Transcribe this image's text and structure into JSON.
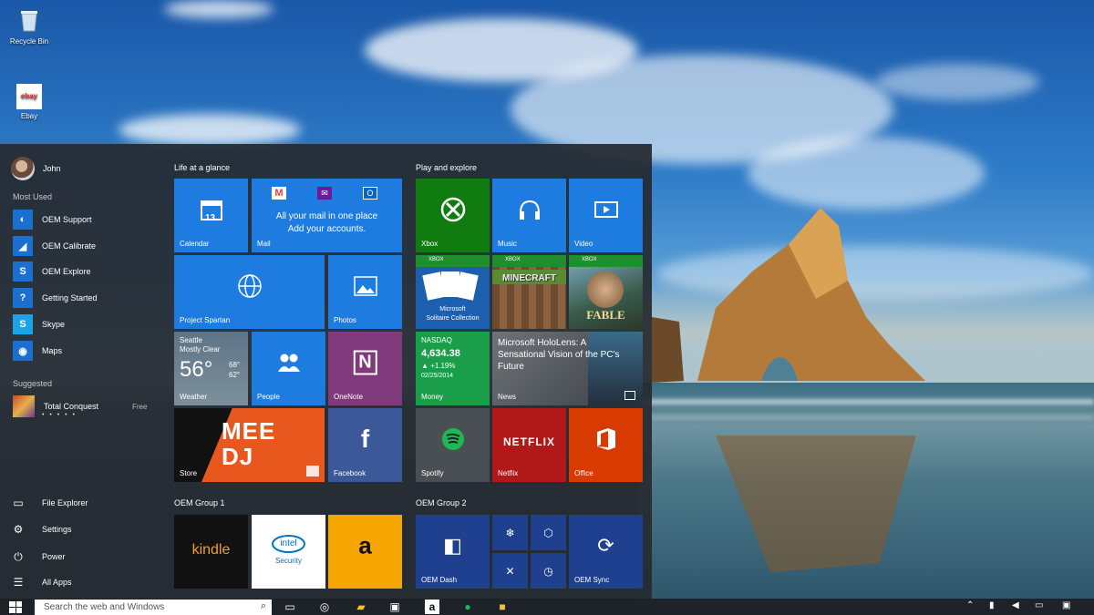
{
  "desktop": {
    "icons": [
      {
        "label": "Recycle Bin",
        "icon": "recycle-bin-icon"
      },
      {
        "label": "Ebay",
        "icon": "ebay-icon",
        "badge": "ebay"
      }
    ]
  },
  "start_menu": {
    "user": {
      "name": "John"
    },
    "most_used_label": "Most Used",
    "most_used": [
      {
        "label": "OEM Support",
        "icon": "oem-support-icon"
      },
      {
        "label": "OEM Calibrate",
        "icon": "oem-calibrate-icon"
      },
      {
        "label": "OEM Explore",
        "icon": "oem-explore-icon"
      },
      {
        "label": "Getting Started",
        "icon": "help-icon"
      },
      {
        "label": "Skype",
        "icon": "skype-icon"
      },
      {
        "label": "Maps",
        "icon": "maps-icon"
      }
    ],
    "suggested_label": "Suggested",
    "suggested": {
      "label": "Total Conquest",
      "note": "Free",
      "rating": "• • • • •"
    },
    "bottom": [
      {
        "label": "File Explorer",
        "icon": "folder-icon"
      },
      {
        "label": "Settings",
        "icon": "gear-icon"
      },
      {
        "label": "Power",
        "icon": "power-icon"
      },
      {
        "label": "All Apps",
        "icon": "list-icon"
      }
    ],
    "groups": {
      "life": "Life at a glance",
      "play": "Play and explore",
      "oem1": "OEM Group 1",
      "oem2": "OEM Group 2"
    },
    "tiles": {
      "calendar": {
        "label": "Calendar",
        "day": "13"
      },
      "mail": {
        "label": "Mail",
        "line1": "All your mail in one place",
        "line2": "Add your accounts."
      },
      "spartan": {
        "label": "Project Spartan"
      },
      "photos": {
        "label": "Photos"
      },
      "weather": {
        "city": "Seattle",
        "condition": "Mostly Clear",
        "temp": "56°",
        "high": "68°",
        "low": "62°",
        "label": "Weather"
      },
      "people": {
        "label": "People"
      },
      "onenote": {
        "label": "OneNote"
      },
      "store": {
        "label": "Store",
        "promo1": "MEE",
        "promo2": "DJ"
      },
      "facebook": {
        "label": "Facebook"
      },
      "xbox": {
        "label": "Xbox"
      },
      "music": {
        "label": "Music"
      },
      "video": {
        "label": "Video"
      },
      "xbox_badge": "XBOX",
      "solitaire": {
        "line1": "Microsoft",
        "line2": "Solitaire Collection"
      },
      "minecraft": {
        "title": "MINECRAFT"
      },
      "fable": {
        "title": "FABLE"
      },
      "money": {
        "index": "NASDAQ",
        "value": "4,634.38",
        "change": "▲ +1.19%",
        "date": "02/25/2014",
        "label": "Money"
      },
      "news": {
        "headline": "Microsoft HoloLens: A Sensational Vision of the PC's Future",
        "label": "News"
      },
      "spotify": {
        "label": "Spotify"
      },
      "netflix": {
        "label": "Netflix",
        "logo": "NETFLIX"
      },
      "office": {
        "label": "Office"
      },
      "kindle": {
        "text": "kindle"
      },
      "intel": {
        "brand": "intel",
        "label": "Security"
      },
      "amazon": {
        "glyph": "a"
      },
      "oem_dash": {
        "label": "OEM Dash"
      },
      "oem_sync": {
        "label": "OEM Sync"
      }
    }
  },
  "taskbar": {
    "search_placeholder": "Search the web and Windows"
  },
  "colors": {
    "tile_blue": "#1e7be0",
    "xbox_green": "#107c10",
    "onenote_purple": "#80397b",
    "store_orange": "#e8581e",
    "facebook_blue": "#3b5998",
    "netflix_red": "#b11818",
    "office_orange": "#d83b01",
    "money_green": "#1b9e4a",
    "oem_navy": "#1f3f8f"
  }
}
